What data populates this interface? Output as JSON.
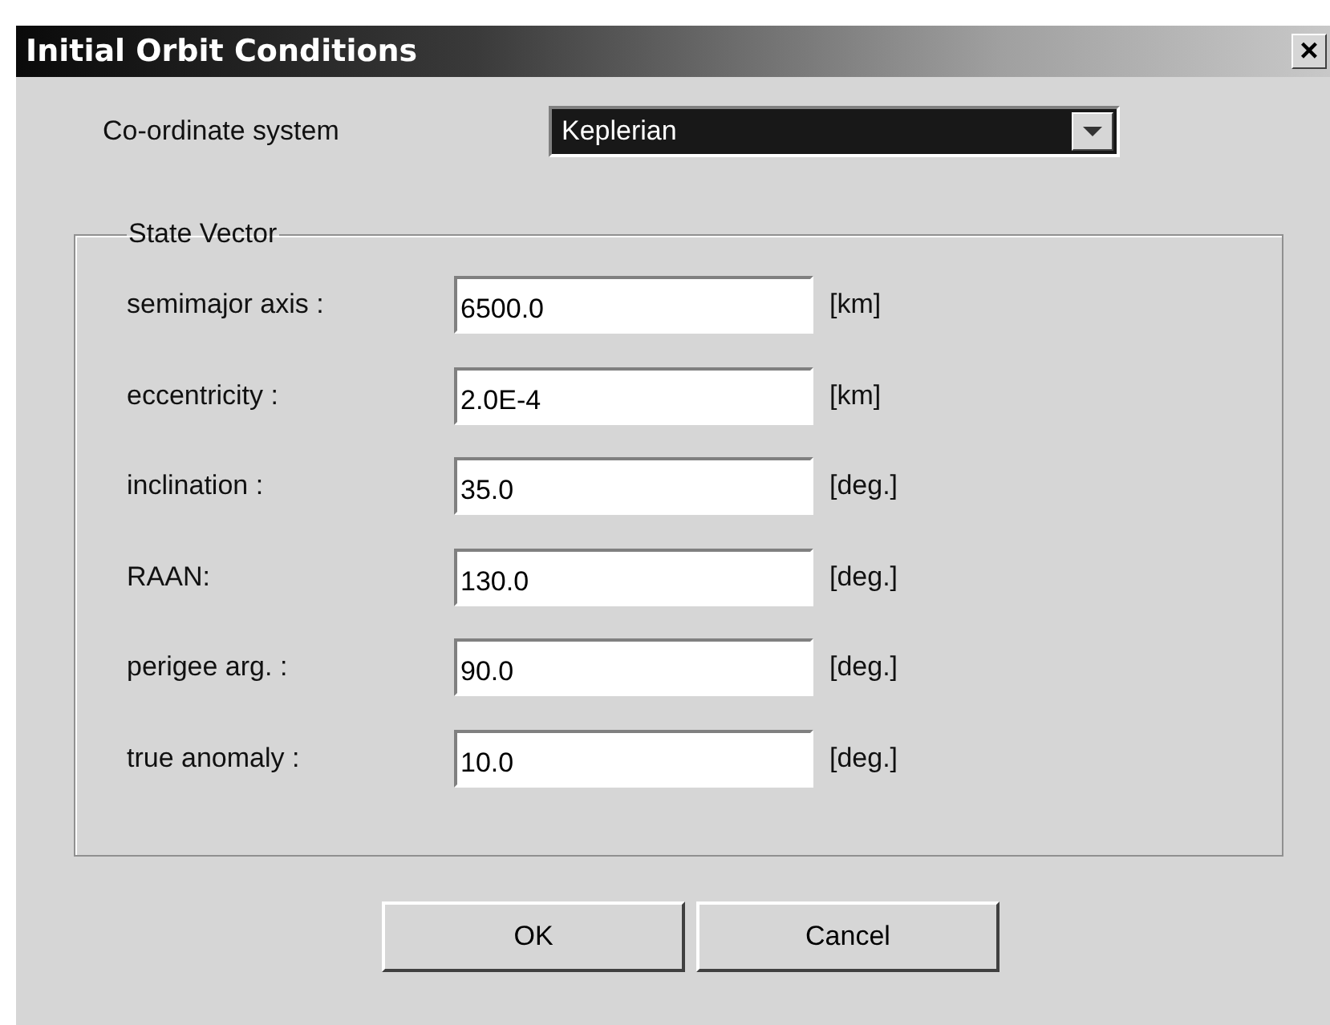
{
  "window": {
    "title": "Initial Orbit Conditions",
    "close": "×"
  },
  "coordinate_system": {
    "label": "Co-ordinate system",
    "value": "Keplerian",
    "focused": true
  },
  "state_vector": {
    "title": "State Vector",
    "fields": [
      {
        "label": "semimajor axis :",
        "value": "6500.0",
        "unit": "[km]"
      },
      {
        "label": "eccentricity :",
        "value": "2.0E-4",
        "unit": "[km]"
      },
      {
        "label": "inclination :",
        "value": "35.0",
        "unit": "[deg.]"
      },
      {
        "label": "RAAN:",
        "value": "130.0",
        "unit": "[deg.]"
      },
      {
        "label": "perigee arg. :",
        "value": "90.0",
        "unit": "[deg.]"
      },
      {
        "label": "true anomaly :",
        "value": "10.0",
        "unit": "[deg.]"
      }
    ]
  },
  "buttons": [
    "OK",
    "Cancel"
  ]
}
